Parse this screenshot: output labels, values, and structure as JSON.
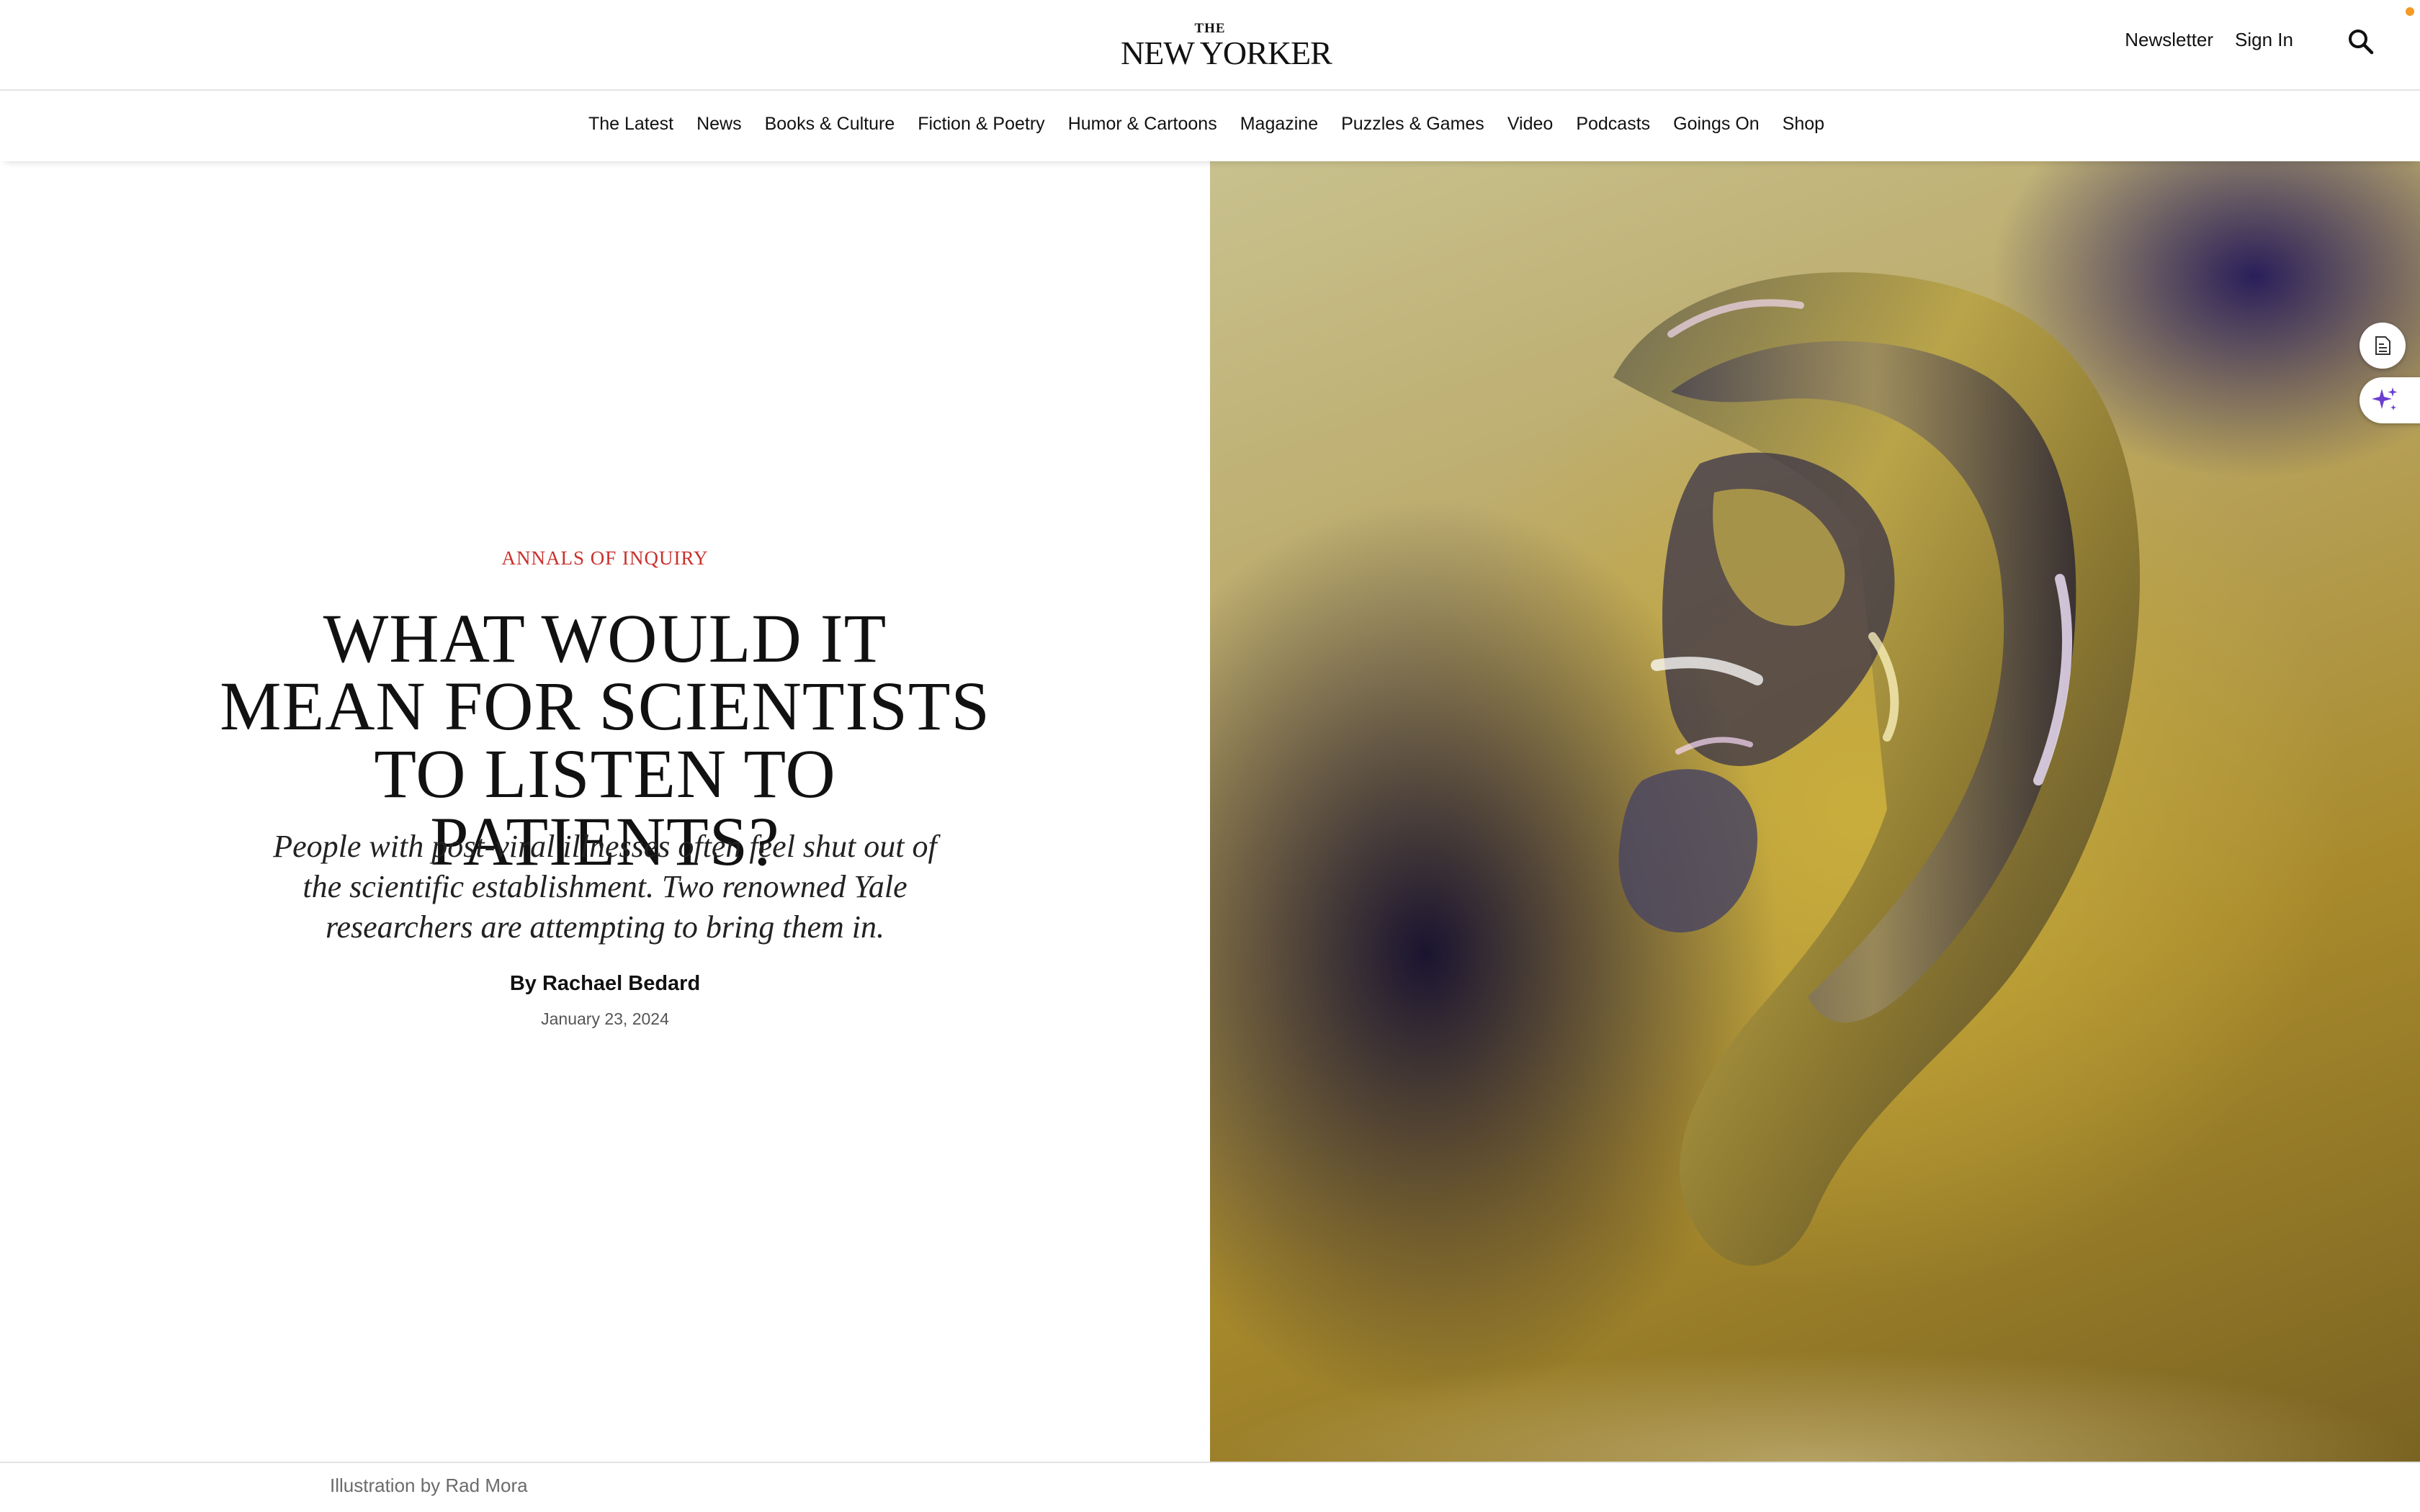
{
  "header": {
    "logo_the": "THE",
    "logo_name": "NEW YORKER",
    "newsletter_label": "Newsletter",
    "signin_label": "Sign In",
    "search_icon": "search-icon",
    "notification_color": "#f59a23"
  },
  "nav": {
    "items": [
      {
        "label": "The Latest"
      },
      {
        "label": "News"
      },
      {
        "label": "Books & Culture"
      },
      {
        "label": "Fiction & Poetry"
      },
      {
        "label": "Humor & Cartoons"
      },
      {
        "label": "Magazine"
      },
      {
        "label": "Puzzles & Games"
      },
      {
        "label": "Video"
      },
      {
        "label": "Podcasts"
      },
      {
        "label": "Goings On"
      },
      {
        "label": "Shop"
      }
    ]
  },
  "article": {
    "rubric": "ANNALS OF INQUIRY",
    "rubric_color": "#c9302c",
    "headline": "WHAT WOULD IT MEAN FOR SCIENTISTS TO LISTEN TO PATIENTS?",
    "dek": "People with post-viral illnesses often feel shut out of the scientific establishment. Two renowned Yale researchers are attempting to bring them in.",
    "byline_prefix": "By",
    "author": "Rachael Bedard",
    "date": "January 23, 2024",
    "image_caption": "Illustration by Rad Mora"
  },
  "side_widgets": {
    "summary_icon": "document-icon",
    "ai_icon": "sparkle-icon",
    "ai_color": "#6a3fd1"
  }
}
